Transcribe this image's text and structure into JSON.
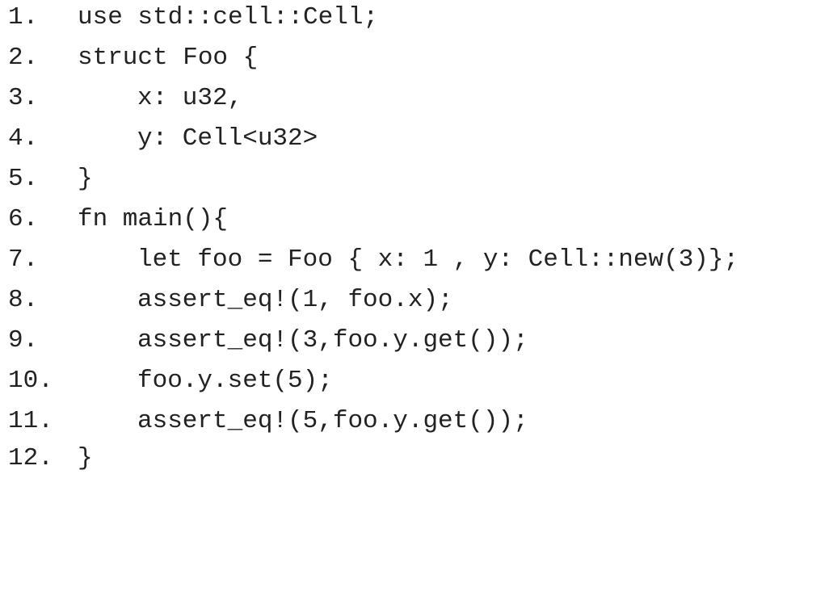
{
  "code_listing": {
    "lines": [
      {
        "number": "1.",
        "code": "use std::cell::Cell;"
      },
      {
        "number": "2.",
        "code": "struct Foo {"
      },
      {
        "number": "3.",
        "code": "x: u32,"
      },
      {
        "number": "4.",
        "code": "y: Cell<u32>"
      },
      {
        "number": "5.",
        "code": "}"
      },
      {
        "number": "6.",
        "code": "fn main(){"
      },
      {
        "number": "7.",
        "code": "let foo = Foo { x: 1 , y: Cell::new(3)};"
      },
      {
        "number": "8.",
        "code": "assert_eq!(1, foo.x);"
      },
      {
        "number": "9.",
        "code": "assert_eq!(3,foo.y.get());"
      },
      {
        "number": "10.",
        "code": "foo.y.set(5);"
      },
      {
        "number": "11.",
        "code": "assert_eq!(5,foo.y.get());"
      },
      {
        "number": "12.",
        "code": "}"
      }
    ]
  }
}
